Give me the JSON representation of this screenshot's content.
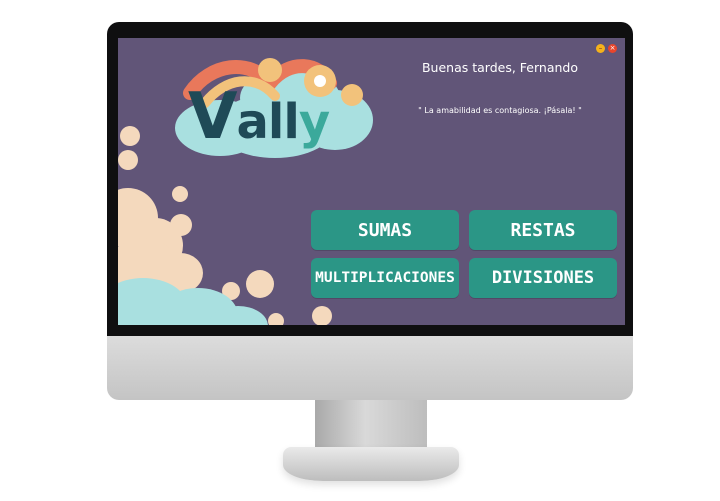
{
  "window": {
    "minimize_symbol": "–",
    "close_symbol": "×"
  },
  "logo": {
    "text_v": "V",
    "text_all": "all",
    "text_y": "y"
  },
  "header": {
    "greeting": "Buenas tardes, Fernando",
    "quote": "\" La amabilidad es contagiosa. ¡Pásala! \""
  },
  "operations": {
    "sumas": "SUMAS",
    "restas": "RESTAS",
    "multiplicaciones": "MULTIPLICACIONES",
    "divisiones": "DIVISIONES"
  },
  "colors": {
    "background": "#615578",
    "button": "#2b9686",
    "peach": "#f4d9bd",
    "teal": "#a9e0e0",
    "minimize": "#f5b21b",
    "close": "#e8452c"
  }
}
